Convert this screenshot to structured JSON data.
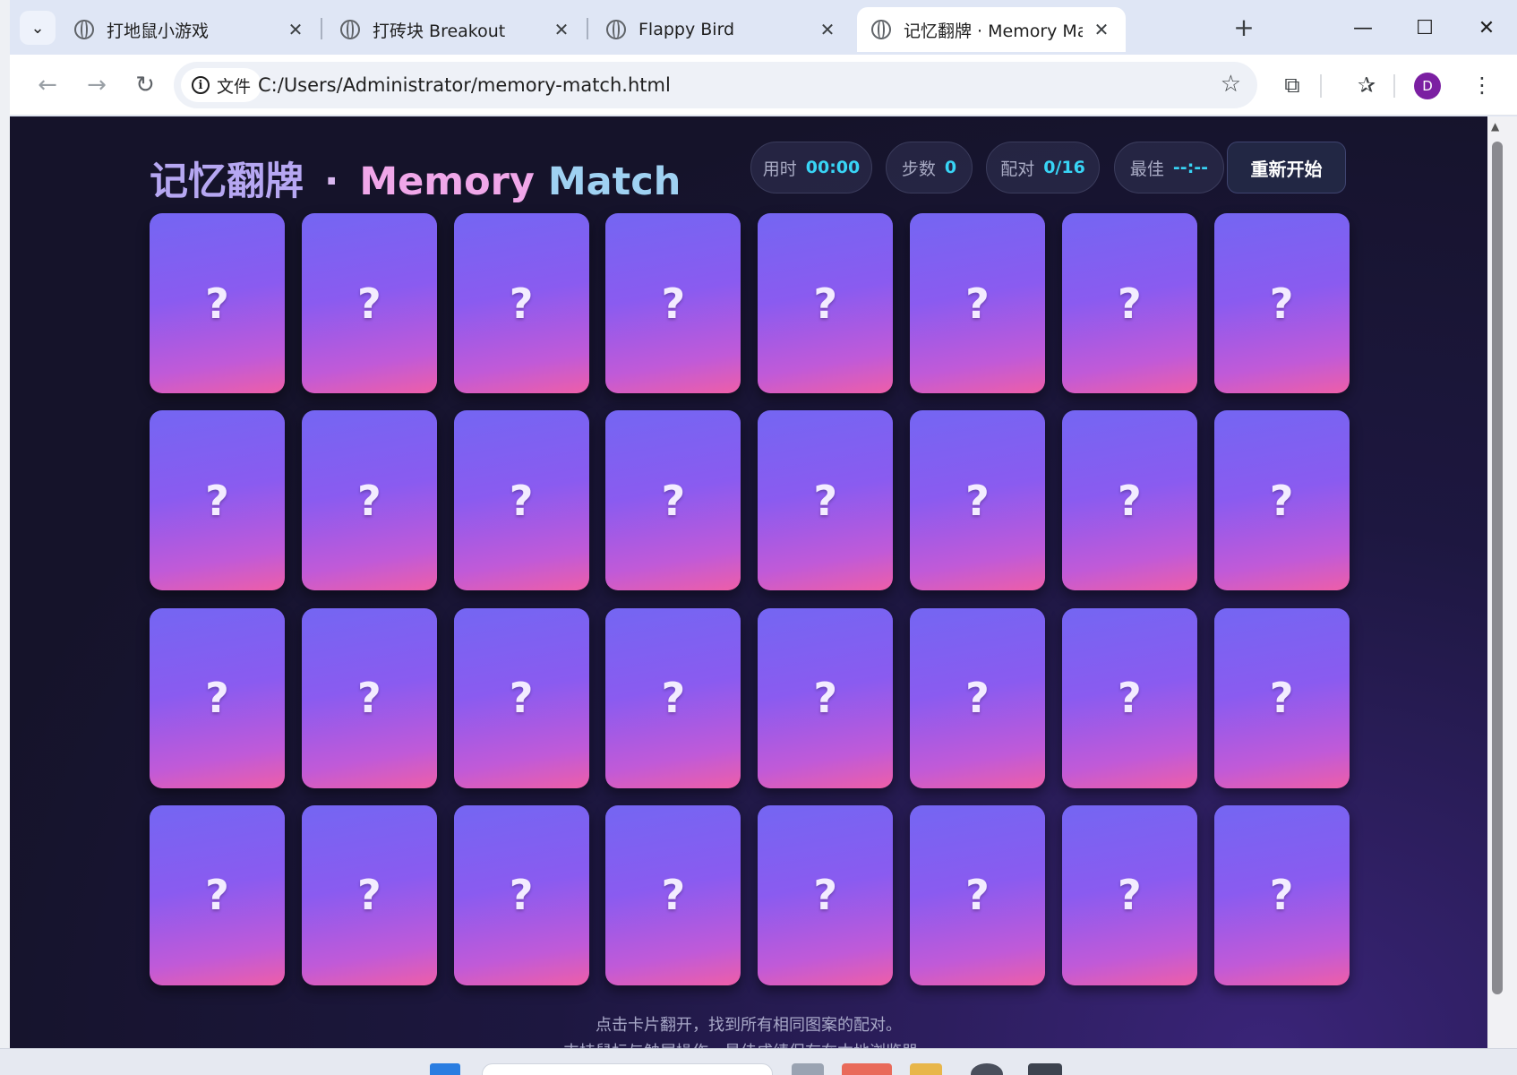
{
  "browser": {
    "tabs": [
      {
        "title": "打地鼠小游戏"
      },
      {
        "title": "打砖块 Breakout"
      },
      {
        "title": "Flappy Bird"
      },
      {
        "title": "记忆翻牌 · Memory Match"
      }
    ],
    "omnibox": {
      "chip_label": "文件",
      "url": "C:/Users/Administrator/memory-match.html"
    },
    "avatar_letter": "D"
  },
  "game": {
    "title_cn": "记忆翻牌",
    "title_dot": "·",
    "title_en1": "Memory",
    "title_en2": "Match",
    "stats": [
      {
        "label": "用时",
        "value": "00:00"
      },
      {
        "label": "步数",
        "value": "0"
      },
      {
        "label": "配对",
        "value": "0/16"
      },
      {
        "label": "最佳",
        "value": "--:--"
      }
    ],
    "restart_label": "重新开始",
    "card_back_symbol": "?",
    "card_count": 32,
    "hint_line1": "点击卡片翻开，找到所有相同图案的配对。",
    "hint_line2": "支持鼠标与触屏操作，最佳成绩保存在本地浏览器。"
  },
  "colors": {
    "accent": "#38d4f5",
    "card_gradient_start": "#7466f2",
    "card_gradient_end": "#ee5ea8"
  }
}
